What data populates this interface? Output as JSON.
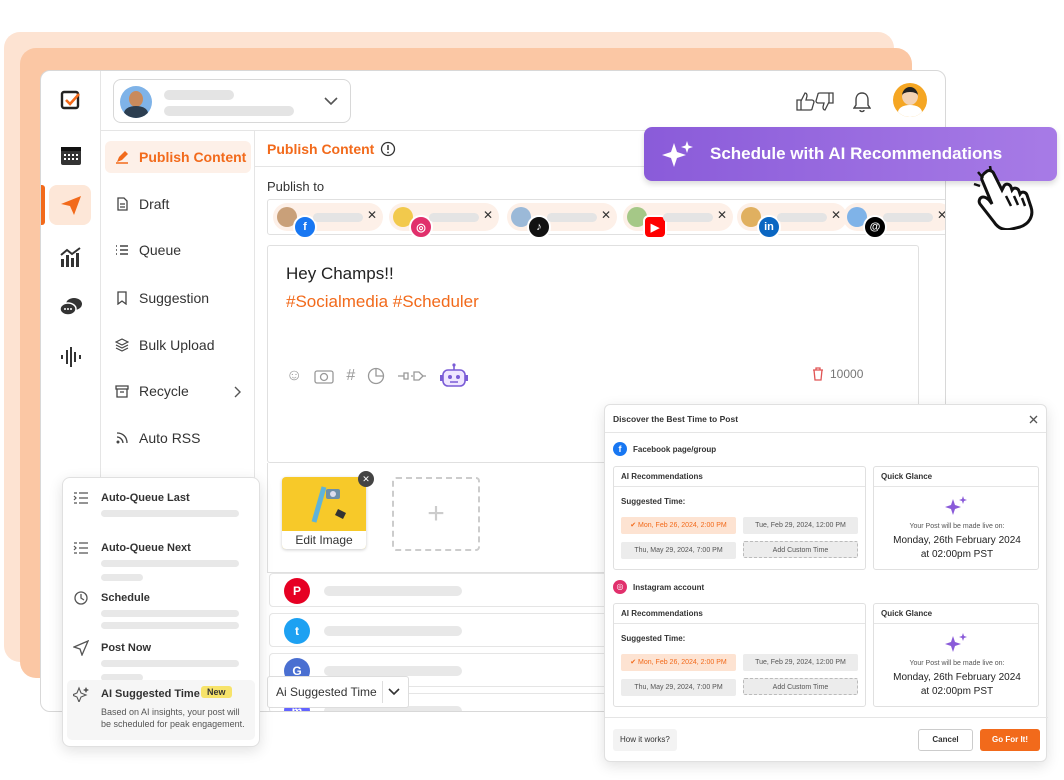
{
  "accent": "#f26a1b",
  "nav_rail": [
    "check-icon",
    "calendar-icon",
    "send-icon",
    "analytics-icon",
    "chat-icon",
    "audio-wave-icon"
  ],
  "sidebar": {
    "items": [
      {
        "label": "Publish Content",
        "icon": "pen-icon"
      },
      {
        "label": "Draft",
        "icon": "document-icon"
      },
      {
        "label": "Queue",
        "icon": "list-icon"
      },
      {
        "label": "Suggestion",
        "icon": "bookmark-icon"
      },
      {
        "label": "Bulk Upload",
        "icon": "layers-icon"
      },
      {
        "label": "Recycle",
        "icon": "archive-icon"
      },
      {
        "label": "Auto RSS",
        "icon": "rss-icon"
      }
    ]
  },
  "main": {
    "title": "Publish Content",
    "publish_to": "Publish to",
    "post_text_line1": "Hey Champs!!",
    "post_text_line2": "#Socialmedia #Scheduler",
    "char_count": "10000",
    "edit_image": "Edit Image",
    "ai_time_select": "Ai Suggested Time"
  },
  "ai_button": {
    "label": "Schedule with AI Recommendations"
  },
  "schedule_menu": {
    "options": [
      {
        "label": "Auto-Queue Last"
      },
      {
        "label": "Auto-Queue Next"
      },
      {
        "label": "Schedule"
      },
      {
        "label": "Post Now"
      }
    ],
    "ai_label": "AI Suggested Time",
    "ai_badge": "New",
    "ai_desc": "Based on AI insights, your post will be scheduled for peak engagement."
  },
  "dialog": {
    "title": "Discover the Best Time to Post",
    "sections": [
      {
        "account": "Facebook page/group",
        "rec_title": "AI Recommendations",
        "suggested": "Suggested Time:",
        "times": [
          "Mon, Feb 26, 2024, 2:00 PM",
          "Tue, Feb 29, 2024, 12:00 PM",
          "Thu, May 29, 2024, 7:00 PM",
          "Add Custom Time"
        ],
        "glance_title": "Quick Glance",
        "glance_text": "Your Post will be made live on:",
        "glance_date": "Monday, 26th February 2024",
        "glance_time": "at 02:00pm PST"
      },
      {
        "account": "Instagram account",
        "rec_title": "AI Recommendations",
        "suggested": "Suggested Time:",
        "times": [
          "Mon, Feb 26, 2024, 2:00 PM",
          "Tue, Feb 29, 2024, 12:00 PM",
          "Thu, May 29, 2024, 7:00 PM",
          "Add Custom Time"
        ],
        "glance_title": "Quick Glance",
        "glance_text": "Your Post will be made live on:",
        "glance_date": "Monday, 26th February 2024",
        "glance_time": "at 02:00pm PST"
      }
    ],
    "how": "How it works?",
    "cancel": "Cancel",
    "go": "Go For It!"
  }
}
